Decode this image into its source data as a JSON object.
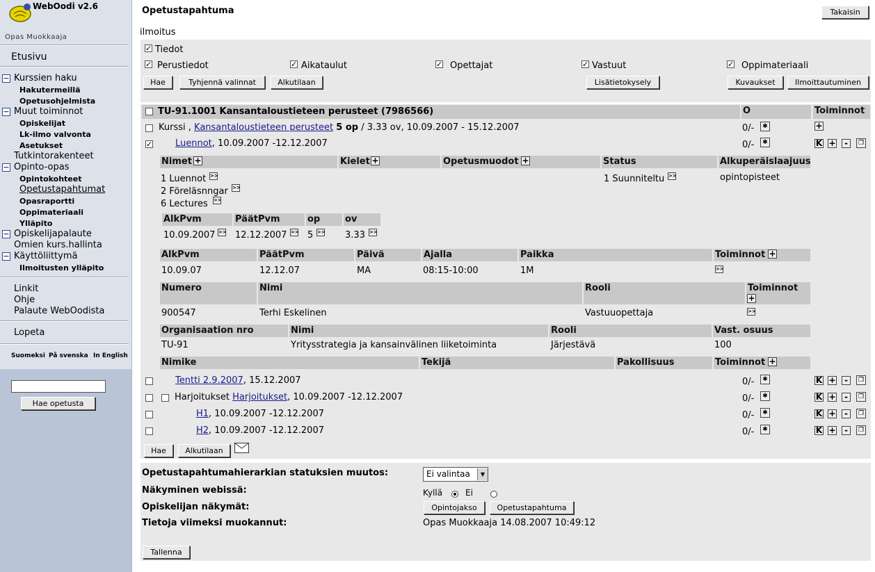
{
  "app": {
    "title": "WebOodi v2.6",
    "user": "Opas Muokkaaja"
  },
  "sidebar": {
    "home": "Etusivu",
    "groups": [
      {
        "label": "Kurssien haku",
        "items": [
          "Hakutermeillä",
          "Opetusohjelmista"
        ]
      },
      {
        "label": "Muut toiminnot",
        "items": [
          "Opiskelijat",
          "Lk-ilmo valvonta",
          "Asetukset"
        ]
      },
      {
        "label": "Tutkintorakenteet",
        "items": []
      },
      {
        "label": "Opinto-opas",
        "items": [
          "Opintokohteet",
          "Opetustapahtumat",
          "Opasraportti",
          "Oppimateriaali",
          "Ylläpito"
        ]
      },
      {
        "label": "Opiskelijapalaute",
        "items": []
      },
      {
        "label": "Omien kurs.hallinta",
        "items": []
      },
      {
        "label": "Käyttöliittymä",
        "items": [
          "Ilmoitusten ylläpito"
        ]
      }
    ],
    "links": [
      "Linkit",
      "Ohje",
      "Palaute WebOodista"
    ],
    "logout": "Lopeta",
    "languages": [
      "Suomeksi",
      "På svenska",
      "In English"
    ],
    "search_button": "Hae opetusta"
  },
  "page": {
    "title": "Opetustapahtuma",
    "back_button": "Takaisin",
    "notice": "ilmoitus"
  },
  "filters": {
    "tiedot": "Tiedot",
    "options": [
      "Perustiedot",
      "Aikataulut",
      "Opettajat",
      "Vastuut",
      "Oppimateriaali"
    ],
    "buttons": {
      "search": "Hae",
      "clear": "Tyhjennä valinnat",
      "initial": "Alkutilaan",
      "extra": "Lisätietokysely",
      "descriptions": "Kuvaukset",
      "registration": "Ilmoittautuminen"
    }
  },
  "course": {
    "header": "TU-91.1001 Kansantaloustieteen perusteet (7986566)",
    "col_o": "O",
    "col_actions": "Toiminnot",
    "row1": {
      "prefix": "Kurssi ,",
      "link": "Kansantaloustieteen perusteet",
      "credits": "5 op",
      "rest": "/ 3.33 ov, 10.09.2007 - 15.12.2007",
      "o": "0/-"
    },
    "row2": {
      "link": "Luennot",
      "rest": ", 10.09.2007 -12.12.2007",
      "o": "0/-"
    },
    "names_table": {
      "headers": [
        "Nimet",
        "Kielet",
        "Opetusmuodot",
        "Status",
        "Alkuperäislaajuus"
      ],
      "names": [
        "1 Luennot",
        "2 Föreläsnngar",
        "6 Lectures"
      ],
      "status": "1 Suunniteltu",
      "extent": "opintopisteet"
    },
    "date_table": {
      "headers": [
        "AlkPvm",
        "PäätPvm",
        "op",
        "ov"
      ],
      "values": [
        "10.09.2007",
        "12.12.2007",
        "5",
        "3.33"
      ]
    },
    "schedule": {
      "headers": [
        "AlkPvm",
        "PäätPvm",
        "Päivä",
        "Ajalla",
        "Paikka",
        "Toiminnot"
      ],
      "row": [
        "10.09.07",
        "12.12.07",
        "MA",
        "08:15-10:00",
        "1M"
      ]
    },
    "teachers": {
      "headers": [
        "Numero",
        "Nimi",
        "Rooli",
        "Toiminnot"
      ],
      "row": [
        "900547",
        "Terhi Eskelinen",
        "Vastuuopettaja"
      ]
    },
    "orgs": {
      "headers": [
        "Organisaation nro",
        "Nimi",
        "Rooli",
        "Vast. osuus"
      ],
      "row": [
        "TU-91",
        "Yritysstrategia ja kansainvälinen liiketoiminta",
        "Järjestävä",
        "100"
      ]
    },
    "materials": {
      "headers": [
        "Nimike",
        "Tekijä",
        "Pakollisuus",
        "Toiminnot"
      ]
    },
    "sub_rows": [
      {
        "link": "Tentti 2.9.2007",
        "rest": ", 15.12.2007",
        "o": "0/-"
      },
      {
        "prefix": "Harjoitukset",
        "link": "Harjoitukset",
        "rest": ", 10.09.2007 -12.12.2007",
        "o": "0/-"
      },
      {
        "link": "H1",
        "rest": ", 10.09.2007 -12.12.2007",
        "o": "0/-"
      },
      {
        "link": "H2",
        "rest": ", 10.09.2007 -12.12.2007",
        "o": "0/-"
      }
    ],
    "bottom_buttons": {
      "search": "Hae",
      "initial": "Alkutilaan"
    }
  },
  "status_form": {
    "status_label": "Opetustapahtumahierarkian statuksien muutos:",
    "status_value": "Ei valintaa",
    "web_label": "Näkyminen webissä:",
    "yes": "Kyllä",
    "no": "Ei",
    "student_label": "Opiskelijan näkymät:",
    "btn_course": "Opintojakso",
    "btn_event": "Opetustapahtuma",
    "modified_label": "Tietoja viimeksi muokannut:",
    "modified_value": "Opas Muokkaaja 14.08.2007 10:49:12",
    "save": "Tallenna"
  },
  "icons": {
    "more": ">>",
    "add": "+",
    "remove": "-",
    "k": "K"
  }
}
